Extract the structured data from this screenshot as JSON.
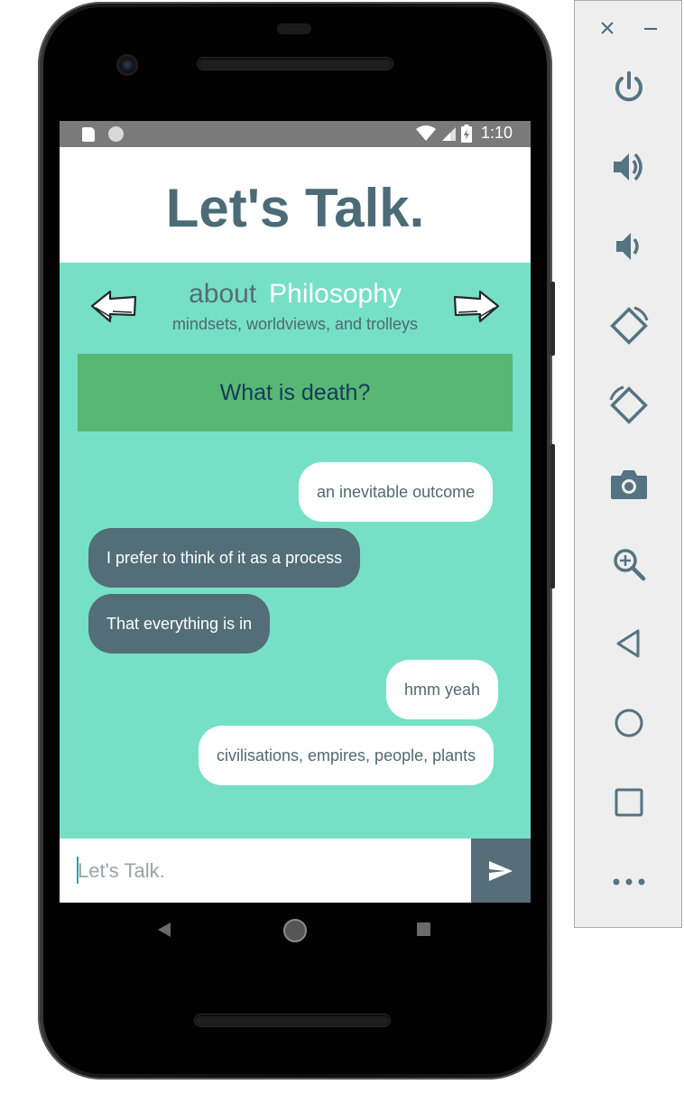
{
  "status_bar": {
    "time": "1:10"
  },
  "header": {
    "title": "Let's Talk."
  },
  "topic": {
    "prefix": "about",
    "name": "Philosophy",
    "subtitle": "mindsets, worldviews, and trolleys"
  },
  "question": "What is death?",
  "messages": [
    {
      "text": "an inevitable outcome",
      "sender": "me"
    },
    {
      "text": "I prefer to think of it as a process",
      "sender": "them"
    },
    {
      "text": "That everything is in",
      "sender": "them"
    },
    {
      "text": "hmm yeah",
      "sender": "me"
    },
    {
      "text": "civilisations, empires, people, plants",
      "sender": "me"
    }
  ],
  "composer": {
    "placeholder": "Let's Talk.",
    "value": ""
  },
  "colors": {
    "header_text": "#4b6b76",
    "background": "#76e0c6",
    "question_box": "#57b873",
    "other_bubble": "#536e78",
    "own_bubble": "#ffffff"
  },
  "icons": {
    "toolbar": [
      "close-icon",
      "minimize-icon",
      "power-icon",
      "volume-up-icon",
      "volume-down-icon",
      "rotate-left-icon",
      "rotate-right-icon",
      "camera-icon",
      "zoom-icon",
      "back-icon",
      "home-icon",
      "overview-icon",
      "more-icon"
    ],
    "app": [
      "prev-topic-arrow-icon",
      "next-topic-arrow-icon",
      "send-icon"
    ]
  }
}
